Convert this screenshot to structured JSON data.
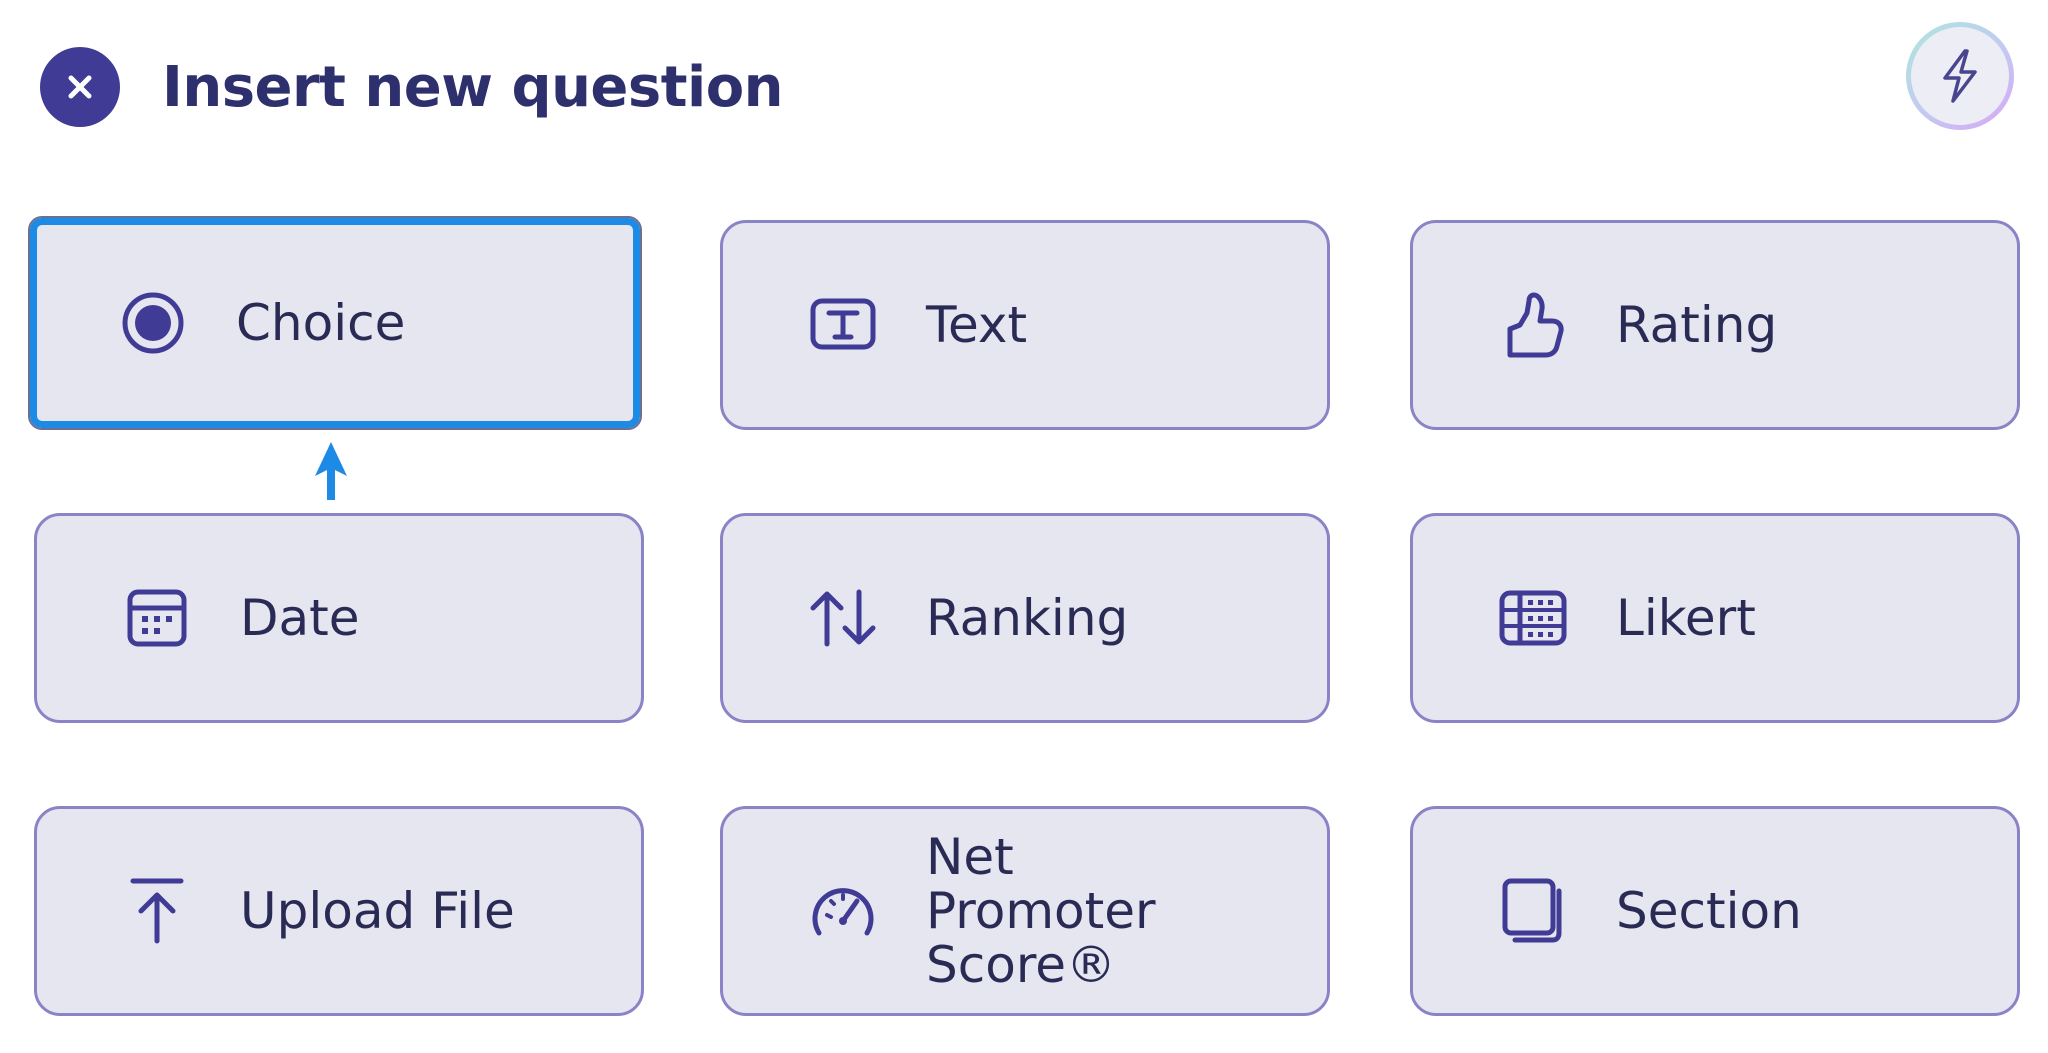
{
  "header": {
    "title": "Insert new question"
  },
  "tiles": [
    {
      "label": "Choice",
      "icon": "radio-button-icon"
    },
    {
      "label": "Text",
      "icon": "text-box-icon"
    },
    {
      "label": "Rating",
      "icon": "thumbs-up-icon"
    },
    {
      "label": "Date",
      "icon": "calendar-icon"
    },
    {
      "label": "Ranking",
      "icon": "sort-arrows-icon"
    },
    {
      "label": "Likert",
      "icon": "likert-grid-icon"
    },
    {
      "label": "Upload File",
      "icon": "upload-icon"
    },
    {
      "label": "Net Promoter Score®",
      "icon": "gauge-icon"
    },
    {
      "label": "Section",
      "icon": "section-icon"
    }
  ],
  "selected_tile": "Choice",
  "colors": {
    "accent": "#403b95",
    "tile_bg": "#e6e6f1",
    "tile_border": "#8a84c6",
    "focus_border": "#1d8ae6"
  }
}
